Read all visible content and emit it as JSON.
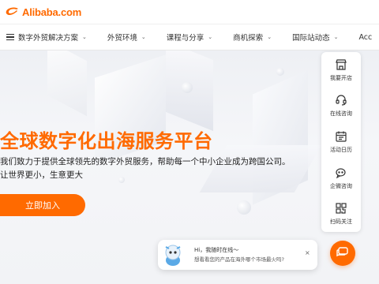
{
  "brand": {
    "name": "Alibaba.com",
    "color": "#ff6a00"
  },
  "nav": {
    "items": [
      {
        "label": "数字外贸解决方案",
        "menu_icon": "hamburger-icon"
      },
      {
        "label": "外贸环境"
      },
      {
        "label": "课程与分享"
      },
      {
        "label": "商机探索"
      },
      {
        "label": "国际站动态"
      },
      {
        "label": "Acc"
      }
    ]
  },
  "hero": {
    "title": "全球数字化出海服务平台",
    "desc_line1": "我们致力于提供全球领先的数字外贸服务，帮助每一个中小企业成为跨国公司。",
    "desc_line2": "让世界更小，生意更大",
    "cta_label": "立即加入"
  },
  "side_panel": {
    "items": [
      {
        "label": "我要开店",
        "icon": "store-icon"
      },
      {
        "label": "在线咨询",
        "icon": "headset-icon"
      },
      {
        "label": "活动日历",
        "icon": "calendar-icon"
      },
      {
        "label": "企微咨询",
        "icon": "wecom-icon"
      },
      {
        "label": "扫码关注",
        "icon": "qrcode-icon"
      }
    ]
  },
  "chat_popup": {
    "line1": "Hi，我随时在线～",
    "line2": "想看看您的产品在海外哪个市场最火吗?",
    "close": "×"
  }
}
